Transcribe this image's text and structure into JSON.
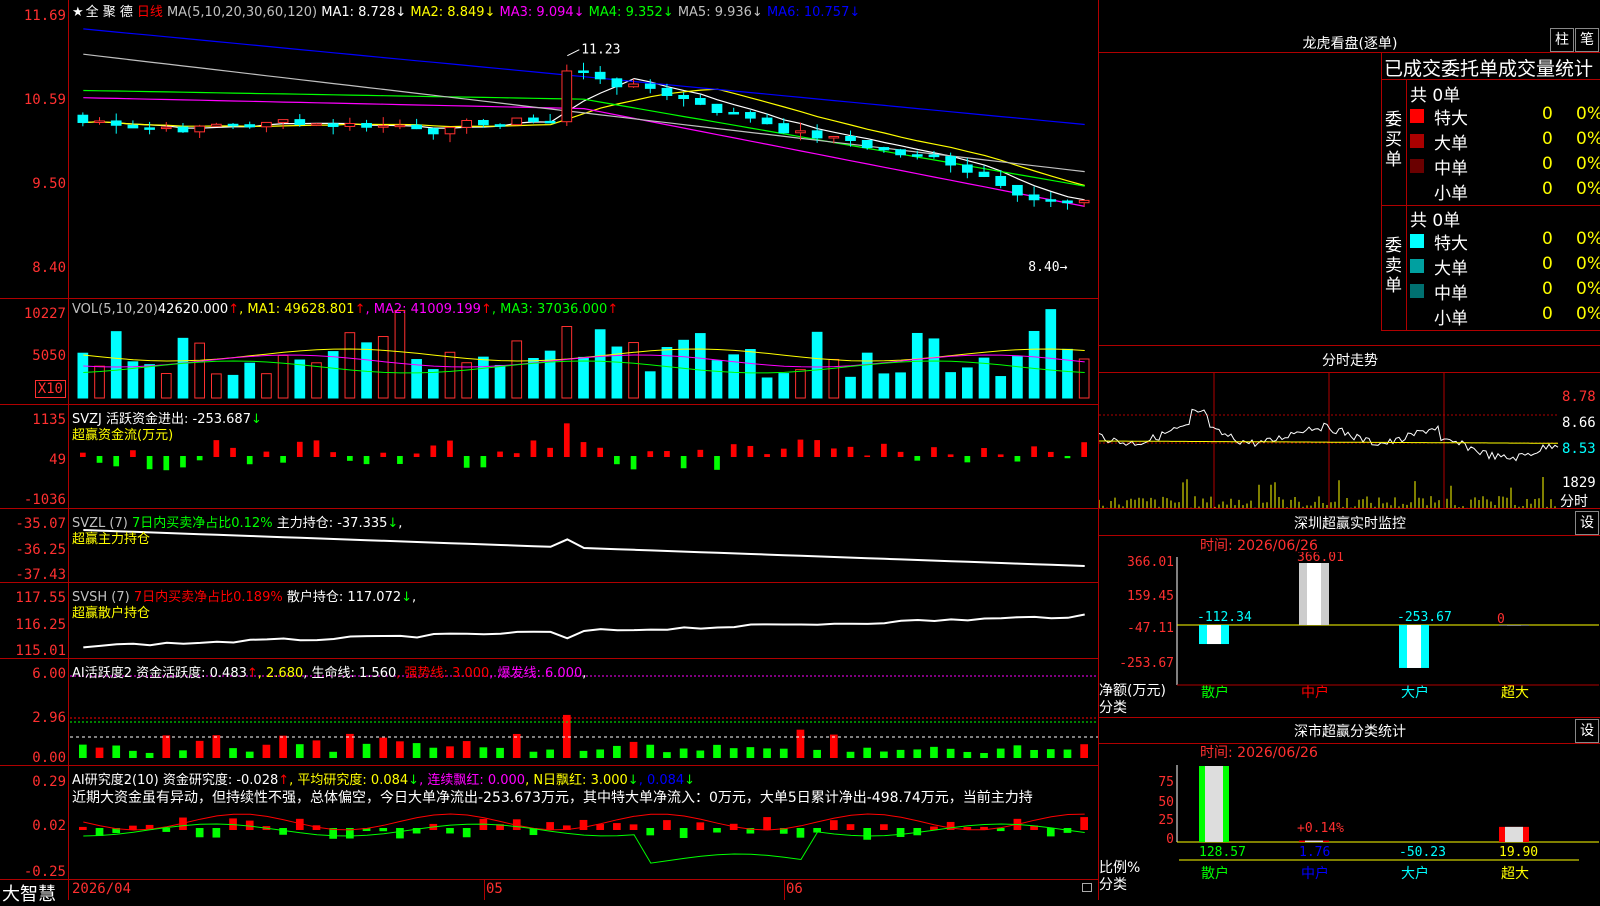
{
  "header": {
    "star": "★",
    "stock_name": "全 聚 德",
    "period": "日线",
    "ma_label": "MA(5,10,20,30,60,120)",
    "ma": [
      {
        "t": "MA1: 8.728↓",
        "color": "#ffffff"
      },
      {
        "t": "MA2: 8.849↓",
        "color": "#ffff00"
      },
      {
        "t": "MA3: 9.094↓",
        "color": "#ff00ff"
      },
      {
        "t": "MA4: 9.352↓",
        "color": "#00ff00"
      },
      {
        "t": "MA5: 9.936↓",
        "color": "#c0c0c0"
      },
      {
        "t": "MA6: 10.757↓",
        "color": "#0000ff"
      }
    ]
  },
  "price_axis": [
    "11.69",
    "10.59",
    "9.50",
    "8.40"
  ],
  "price_annotations": {
    "high": "11.23",
    "low": "8.40"
  },
  "vol": {
    "line": [
      {
        "t": "VOL(5,10,20)",
        "color": "#c0c0c0"
      },
      {
        "t": "42620.000",
        "color": "#ffffff"
      },
      {
        "t": "↑",
        "color": "#ff0000"
      },
      {
        "t": ", MA1: 49628.801",
        "color": "#ffff00"
      },
      {
        "t": "↑",
        "color": "#ff0000"
      },
      {
        "t": ", MA2: 41009.199",
        "color": "#ff00ff"
      },
      {
        "t": "↑",
        "color": "#ff0000"
      },
      {
        "t": ", MA3: 37036.000",
        "color": "#00ff00"
      },
      {
        "t": "↑",
        "color": "#ff0000"
      }
    ],
    "axis": [
      "10227",
      "5050"
    ],
    "unit": "X10"
  },
  "svzj": {
    "line": [
      {
        "t": "SVZJ  活跃资金进出: -253.687",
        "color": "#ffffff"
      },
      {
        "t": "↓",
        "color": "#00ff00"
      }
    ],
    "sub": "超赢资金流(万元)",
    "axis": [
      "1135",
      "49",
      "-1036"
    ]
  },
  "svzl": {
    "line": [
      {
        "t": "SVZL (7) ",
        "color": "#c0c0c0"
      },
      {
        "t": "7日内买卖净占比0.12%",
        "color": "#00ff00"
      },
      {
        "t": " 主力持仓: -37.335",
        "color": "#ffffff"
      },
      {
        "t": "↓",
        "color": "#00ff00"
      },
      {
        "t": ",",
        "color": "#ffffff"
      }
    ],
    "sub": "超赢主力持仓",
    "axis": [
      "-35.07",
      "-36.25",
      "-37.43"
    ]
  },
  "svsh": {
    "line": [
      {
        "t": "SVSH (7) ",
        "color": "#c0c0c0"
      },
      {
        "t": "7日内买卖净占比0.189%",
        "color": "#ff0000"
      },
      {
        "t": " 散户持仓: 117.072",
        "color": "#ffffff"
      },
      {
        "t": "↓",
        "color": "#00ff00"
      },
      {
        "t": ",",
        "color": "#ffffff"
      }
    ],
    "sub": "超赢散户持仓",
    "axis": [
      "117.55",
      "116.25",
      "115.01"
    ]
  },
  "ai1": {
    "line": [
      {
        "t": "AI活跃度2 资金活跃度: 0.483",
        "color": "#ffffff"
      },
      {
        "t": "↑",
        "color": "#ff0000"
      },
      {
        "t": ", 2.680",
        "color": "#ffff00"
      },
      {
        "t": ", 生命线: 1.560",
        "color": "#ffffff"
      },
      {
        "t": ", 强势线: 3.000",
        "color": "#ff0000"
      },
      {
        "t": ", 爆发线: 6.000",
        "color": "#ff00ff"
      },
      {
        "t": ",",
        "color": "#ffffff"
      }
    ],
    "axis": [
      "6.00",
      "2.96",
      "0.00"
    ]
  },
  "ai2": {
    "line": [
      {
        "t": "AI研究度2(10) 资金研究度: -0.028",
        "color": "#ffffff"
      },
      {
        "t": "↑",
        "color": "#ff0000"
      },
      {
        "t": ", 平均研究度: 0.084",
        "color": "#ffff00"
      },
      {
        "t": "↓",
        "color": "#00ff00"
      },
      {
        "t": ", 连续飘红: 0.000",
        "color": "#ff00ff"
      },
      {
        "t": ", N日飘红: 3.000",
        "color": "#ffff00"
      },
      {
        "t": "↓",
        "color": "#00ff00"
      },
      {
        "t": ", 0.084",
        "color": "#0000ff"
      },
      {
        "t": "↓",
        "color": "#00ff00"
      }
    ],
    "comment": "近期大资金虽有异动，但持续性不强，总体偏空，今日大单净流出-253.673万元，其中特大单净流入：0万元，大单5日累计净出-498.74万元，当前主力持",
    "axis": [
      "0.29",
      "0.02",
      "-0.25"
    ]
  },
  "xaxis": {
    "dates": [
      "2026/04",
      "05",
      "06"
    ]
  },
  "brand": "大智慧",
  "lhb": {
    "title": "龙虎看盘(逐单)",
    "btn1": "柱",
    "btn2": "笔",
    "subtitle": "已成交委托单成交量统计",
    "buy": {
      "side": "委买单",
      "count": "共 0单",
      "rows": [
        {
          "label": "特大",
          "val": "0",
          "pct": "0%",
          "color": "#ff0000"
        },
        {
          "label": "大单",
          "val": "0",
          "pct": "0%",
          "color": "#aa0000"
        },
        {
          "label": "中单",
          "val": "0",
          "pct": "0%",
          "color": "#6a0000"
        },
        {
          "label": "小单",
          "val": "0",
          "pct": "0%",
          "color": ""
        }
      ]
    },
    "sell": {
      "side": "委卖单",
      "count": "共 0单",
      "rows": [
        {
          "label": "特大",
          "val": "0",
          "pct": "0%",
          "color": "#00ffff"
        },
        {
          "label": "大单",
          "val": "0",
          "pct": "0%",
          "color": "#00a0a0"
        },
        {
          "label": "中单",
          "val": "0",
          "pct": "0%",
          "color": "#007070"
        },
        {
          "label": "小单",
          "val": "0",
          "pct": "0%",
          "color": ""
        }
      ]
    }
  },
  "fenshi": {
    "title": "分时走势",
    "axis": [
      "8.78",
      "8.66",
      "8.53"
    ],
    "vol": "1829",
    "vol_unit": "分时"
  },
  "monitor": {
    "title": "深圳超赢实时监控",
    "btn": "设",
    "time": "时间: 2026/06/26",
    "axis": [
      "366.01",
      "159.45",
      "-47.11",
      "-253.67"
    ],
    "ylabel": "净额(万元)",
    "xlabel": "分类",
    "bars": [
      {
        "cat": "散户",
        "value": -112.34,
        "label": "-112.34",
        "cat_color": "#00ff00"
      },
      {
        "cat": "中户",
        "value": 366.01,
        "label": "366.01",
        "cat_color": "#ff0000"
      },
      {
        "cat": "大户",
        "value": -253.67,
        "label": "-253.67",
        "cat_color": "#00ffff"
      },
      {
        "cat": "超大",
        "value": 0,
        "label": "0",
        "cat_color": "#ffff00"
      }
    ]
  },
  "classify": {
    "title": "深市超赢分类统计",
    "btn": "设",
    "time": "时间: 2026/06/26",
    "axis": [
      "75",
      "50",
      "25",
      "0"
    ],
    "ylabel": "比例%",
    "xlabel": "分类",
    "bars": [
      {
        "cat": "散户",
        "value": 128.57,
        "label": "128.57",
        "top_label": "",
        "cat_color": "#00ff00"
      },
      {
        "cat": "中户",
        "value": 1.76,
        "label": "1.76",
        "top_label": "+0.14%",
        "cat_color": "#0000ff"
      },
      {
        "cat": "大户",
        "value": -50.23,
        "label": "-50.23",
        "top_label": "",
        "cat_color": "#00ffff"
      },
      {
        "cat": "超大",
        "value": 19.9,
        "label": "19.90",
        "top_label": "",
        "cat_color": "#ffff00"
      }
    ]
  }
}
